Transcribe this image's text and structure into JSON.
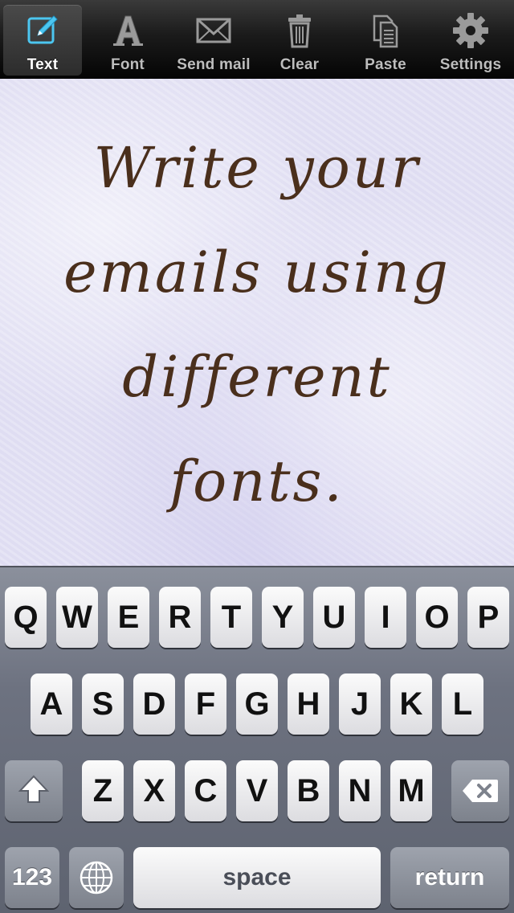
{
  "toolbar": {
    "items": [
      {
        "label": "Text",
        "icon": "edit-pencil-icon",
        "active": true
      },
      {
        "label": "Font",
        "icon": "font-letter-a-icon",
        "active": false
      },
      {
        "label": "Send mail",
        "icon": "envelope-icon",
        "active": false
      },
      {
        "label": "Clear",
        "icon": "trash-icon",
        "active": false
      },
      {
        "label": "Paste",
        "icon": "paste-document-icon",
        "active": false
      },
      {
        "label": "Settings",
        "icon": "gear-icon",
        "active": false
      }
    ]
  },
  "editor": {
    "lines": [
      "Write your",
      "emails using",
      "different",
      "fonts."
    ],
    "text_color": "#4a2f1c",
    "paper_color": "#e3e1f4"
  },
  "keyboard": {
    "row1": [
      "Q",
      "W",
      "E",
      "R",
      "T",
      "Y",
      "U",
      "I",
      "O",
      "P"
    ],
    "row2": [
      "A",
      "S",
      "D",
      "F",
      "G",
      "H",
      "J",
      "K",
      "L"
    ],
    "row3": [
      "Z",
      "X",
      "C",
      "V",
      "B",
      "N",
      "M"
    ],
    "numbers_label": "123",
    "space_label": "space",
    "return_label": "return",
    "shift_icon": "shift-arrow-icon",
    "globe_icon": "globe-icon",
    "delete_icon": "backspace-icon"
  }
}
